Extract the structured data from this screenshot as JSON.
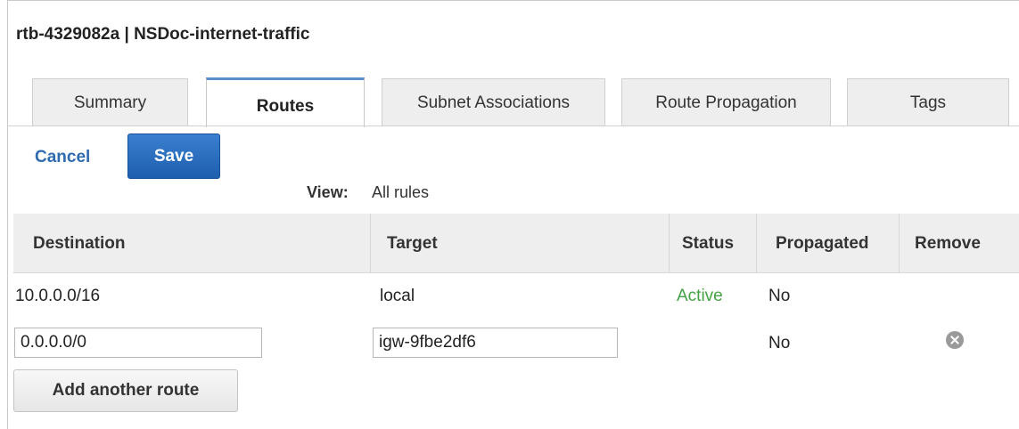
{
  "header": {
    "title": "rtb-4329082a | NSDoc-internet-traffic"
  },
  "tabs": [
    {
      "label": "Summary"
    },
    {
      "label": "Routes"
    },
    {
      "label": "Subnet Associations"
    },
    {
      "label": "Route Propagation"
    },
    {
      "label": "Tags"
    }
  ],
  "active_tab": "Routes",
  "toolbar": {
    "cancel_label": "Cancel",
    "save_label": "Save"
  },
  "view": {
    "label": "View:",
    "value": "All rules"
  },
  "table": {
    "columns": [
      "Destination",
      "Target",
      "Status",
      "Propagated",
      "Remove"
    ],
    "rows": [
      {
        "destination": "10.0.0.0/16",
        "target": "local",
        "status": "Active",
        "propagated": "No"
      }
    ],
    "edit_row": {
      "destination": "0.0.0.0/0",
      "target": "igw-9fbe2df6",
      "propagated": "No",
      "remove_icon": "remove-circle-icon"
    }
  },
  "add_route_label": "Add another route",
  "colors": {
    "accent": "#2e6bb0",
    "status_active": "#43a243",
    "tab_active_border": "#5b8fc7"
  }
}
